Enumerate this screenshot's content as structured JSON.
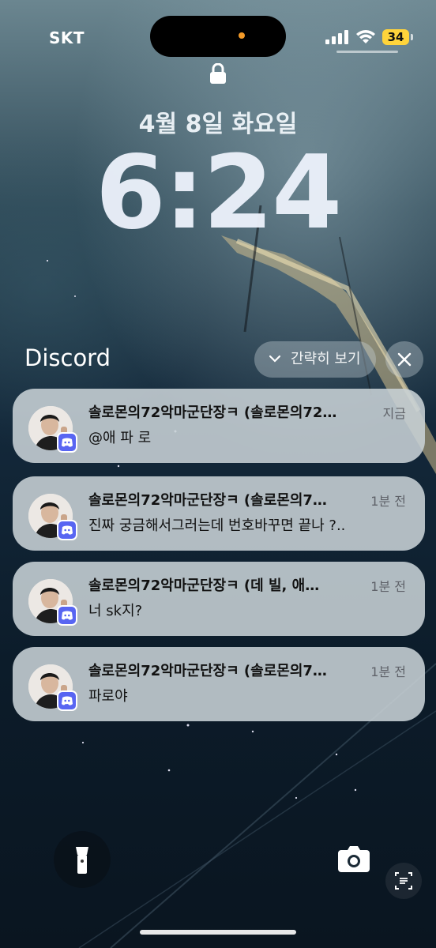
{
  "status_bar": {
    "carrier": "SKT",
    "battery_level": "34",
    "signal_icon": "cellular-signal-icon",
    "wifi_icon": "wifi-icon"
  },
  "lock_screen": {
    "date": "4월 8일 화요일",
    "time": "6:24"
  },
  "notification_group": {
    "app_name": "Discord",
    "collapse_label": "간략히 보기",
    "close_icon": "close-icon"
  },
  "notifications": [
    {
      "title": "솔로몬의72악마군단장ㅋ (솔로몬의72…",
      "time": "지금",
      "body": "@애 파 로"
    },
    {
      "title": "솔로몬의72악마군단장ㅋ (솔로몬의7…",
      "time": "1분 전",
      "body": "진짜 궁금해서그러는데 번호바꾸면 끝나 ?.."
    },
    {
      "title": "솔로몬의72악마군단장ㅋ (데 빌, 애…",
      "time": "1분 전",
      "body": "너 sk지?"
    },
    {
      "title": "솔로몬의72악마군단장ㅋ (솔로몬의7…",
      "time": "1분 전",
      "body": "파로야"
    }
  ],
  "bottom_controls": {
    "flashlight_icon": "flashlight-icon",
    "camera_icon": "camera-icon",
    "scan_icon": "live-text-icon"
  },
  "colors": {
    "discord_brand": "#5865F2",
    "battery": "#ffd43b",
    "privacy_dot": "#f39a28"
  }
}
